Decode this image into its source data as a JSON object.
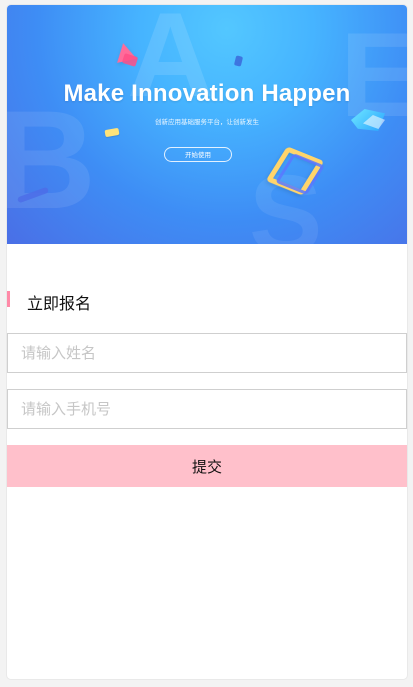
{
  "banner": {
    "title": "Make Innovation Happen",
    "subtitle": "创新应用基础服务平台，让创新发生",
    "start_button": "开始使用",
    "background_letters": [
      "A",
      "B",
      "E",
      "S"
    ]
  },
  "signup": {
    "section_title": "立即报名",
    "name_placeholder": "请输入姓名",
    "phone_placeholder": "请输入手机号",
    "submit_label": "提交"
  },
  "colors": {
    "accent": "#ff8aa8",
    "submit_bg": "#ffc0cb",
    "banner_blue": "#3e8df5"
  }
}
